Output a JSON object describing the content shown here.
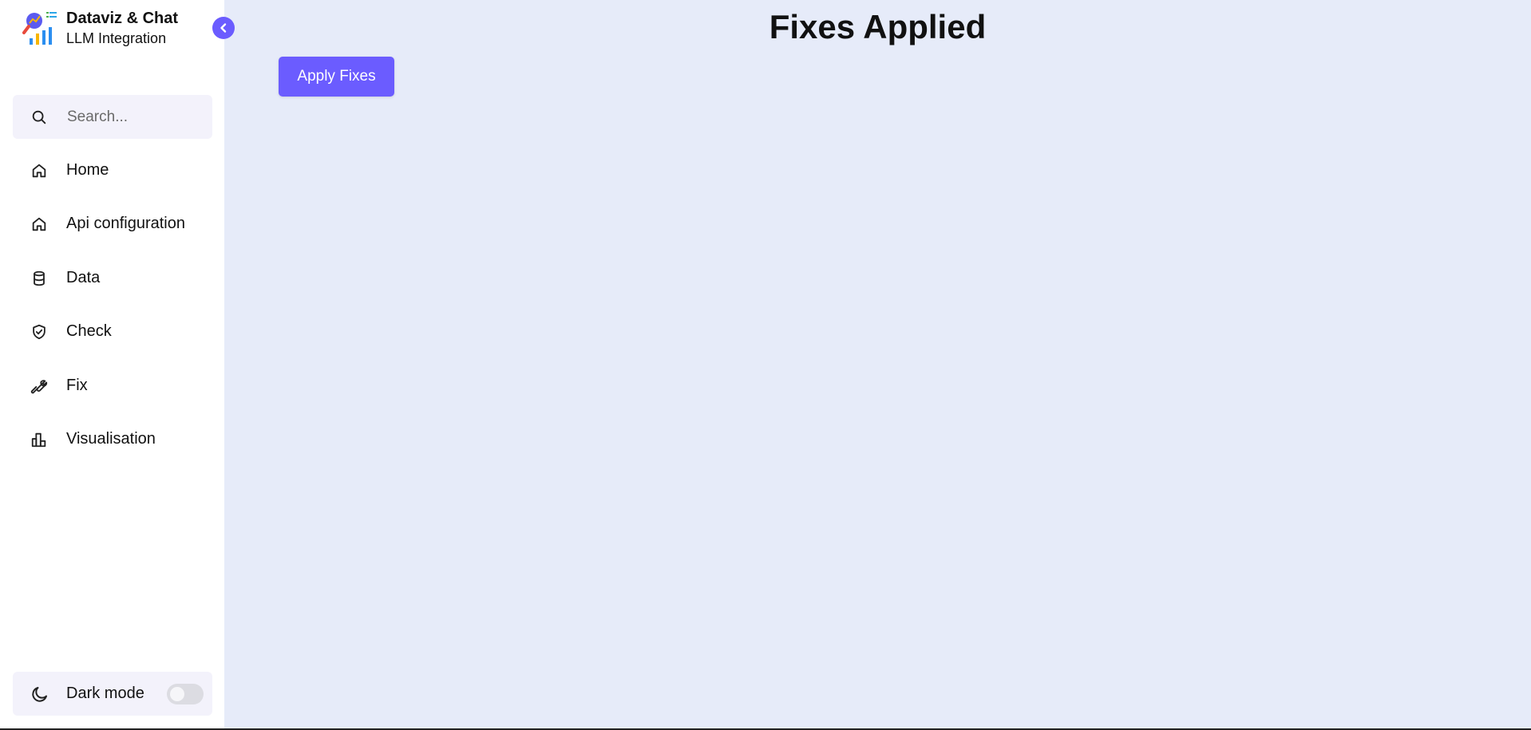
{
  "brand": {
    "title": "Dataviz & Chat",
    "subtitle": "LLM Integration",
    "logo_icon": "chart-search-logo-icon"
  },
  "sidebar": {
    "collapse_icon": "chevron-left-icon",
    "search": {
      "placeholder": "Search...",
      "value": "",
      "icon": "search-icon"
    },
    "items": [
      {
        "label": "Home",
        "icon": "home-icon"
      },
      {
        "label": "Api configuration",
        "icon": "home-icon"
      },
      {
        "label": "Data",
        "icon": "database-icon"
      },
      {
        "label": "Check",
        "icon": "shield-check-icon"
      },
      {
        "label": "Fix",
        "icon": "wrench-icon"
      },
      {
        "label": "Visualisation",
        "icon": "bar-chart-icon"
      }
    ],
    "dark_mode": {
      "label": "Dark mode",
      "icon": "moon-icon",
      "enabled": false
    }
  },
  "main": {
    "title": "Fixes Applied",
    "apply_button_label": "Apply Fixes"
  },
  "colors": {
    "accent": "#6b5cff",
    "main_background": "#e6ebf9",
    "sidebar_background": "#ffffff",
    "input_background": "#f3f2fb"
  }
}
